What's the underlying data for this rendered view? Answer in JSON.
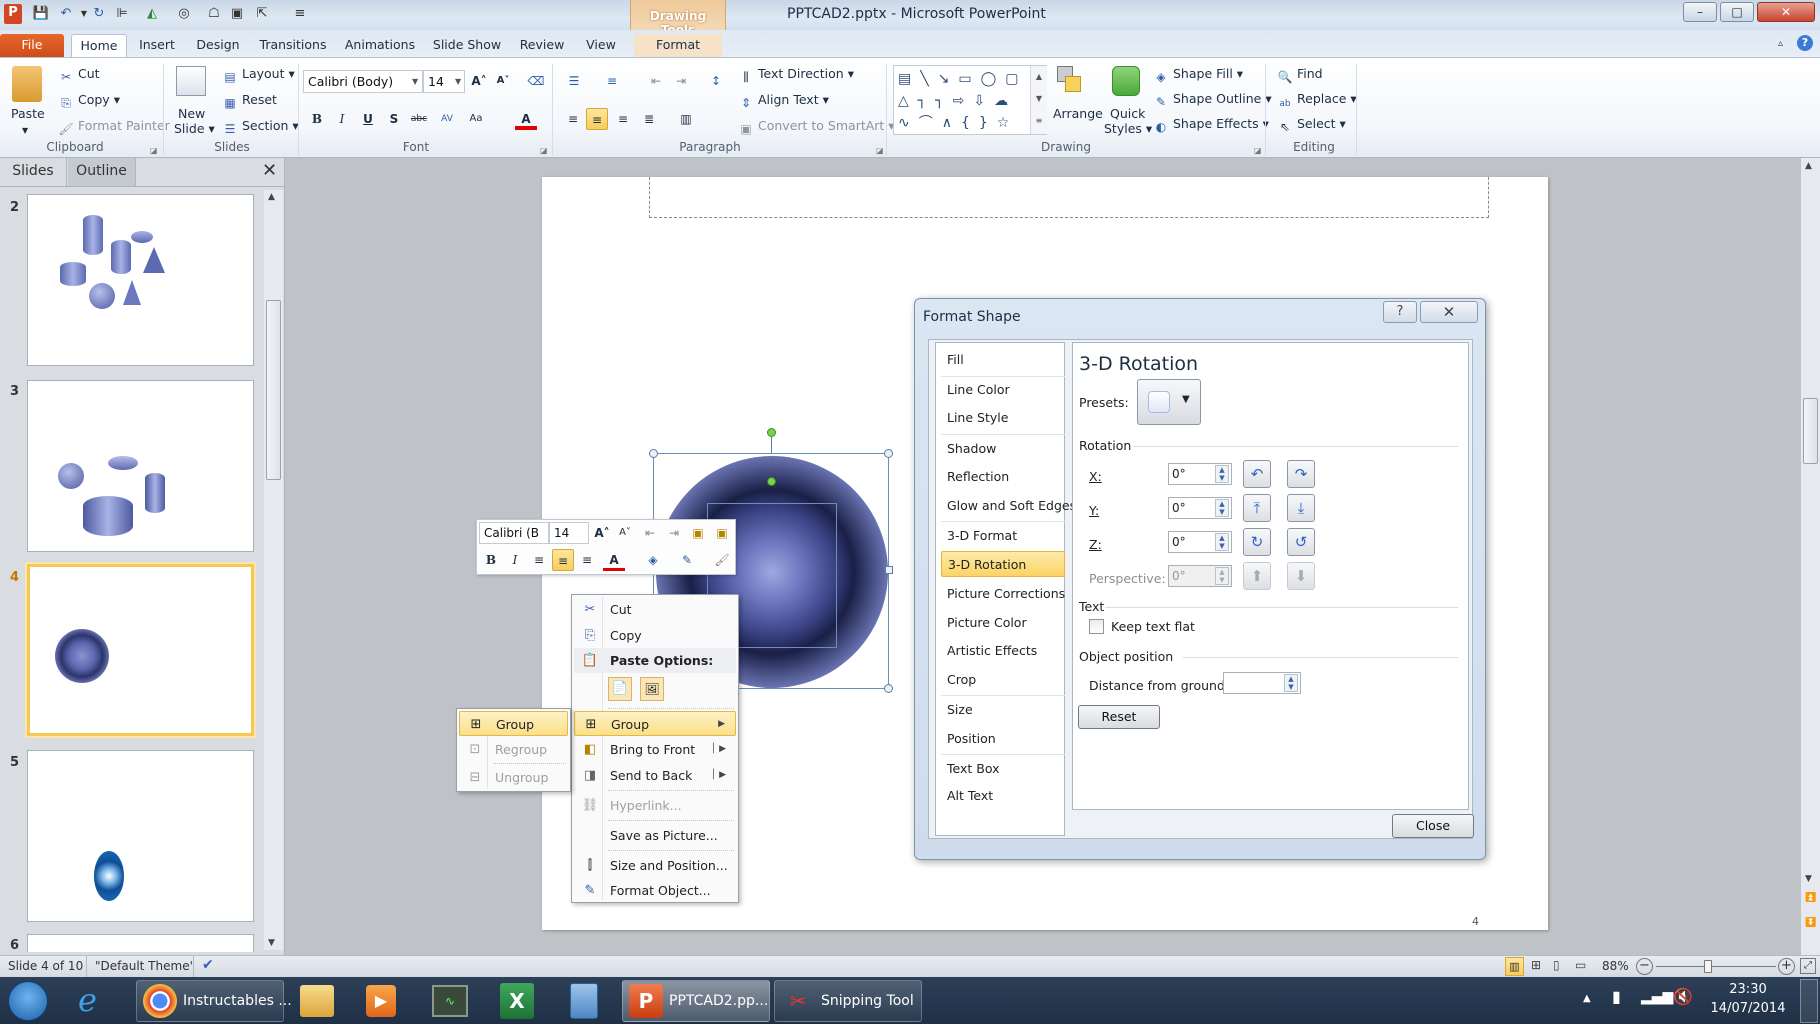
{
  "window": {
    "title": "PPTCAD2.pptx - Microsoft PowerPoint",
    "contextual_tab_group": "Drawing Tools",
    "controls": {
      "minimize": "–",
      "maximize": "□",
      "close": "✕"
    }
  },
  "quick_access": {
    "icons": [
      "save-icon",
      "undo-icon",
      "redo-icon",
      "align-icon",
      "fill-icon",
      "shapes-icon",
      "shape-icon",
      "resize-icon",
      "select-icon",
      "customize-icon"
    ]
  },
  "tabs": [
    {
      "label": "File"
    },
    {
      "label": "Home"
    },
    {
      "label": "Insert"
    },
    {
      "label": "Design"
    },
    {
      "label": "Transitions"
    },
    {
      "label": "Animations"
    },
    {
      "label": "Slide Show"
    },
    {
      "label": "Review"
    },
    {
      "label": "View"
    },
    {
      "label": "Format"
    }
  ],
  "ribbon": {
    "clipboard": {
      "label": "Clipboard",
      "paste": "Paste",
      "cut": "Cut",
      "copy": "Copy",
      "format_painter": "Format Painter"
    },
    "slides": {
      "label": "Slides",
      "new_slide_1": "New",
      "new_slide_2": "Slide",
      "layout": "Layout",
      "reset": "Reset",
      "section": "Section"
    },
    "font": {
      "label": "Font",
      "font_name": "Calibri (Body)",
      "font_size": "14"
    },
    "paragraph": {
      "label": "Paragraph",
      "text_direction": "Text Direction",
      "align_text": "Align Text",
      "convert_smartart": "Convert to SmartArt"
    },
    "drawing": {
      "label": "Drawing",
      "arrange": "Arrange",
      "quick_styles_1": "Quick",
      "quick_styles_2": "Styles",
      "shape_fill": "Shape Fill",
      "shape_outline": "Shape Outline",
      "shape_effects": "Shape Effects"
    },
    "editing": {
      "label": "Editing",
      "find": "Find",
      "replace": "Replace",
      "select": "Select"
    }
  },
  "left_pane": {
    "tabs": [
      "Slides",
      "Outline"
    ],
    "slides": [
      {
        "number": "2"
      },
      {
        "number": "3"
      },
      {
        "number": "4",
        "selected": true
      },
      {
        "number": "5"
      },
      {
        "number": "6"
      }
    ]
  },
  "slide": {
    "page_number": "4"
  },
  "mini_toolbar": {
    "font_name": "Calibri (B",
    "font_size": "14"
  },
  "context_menu": {
    "items": [
      {
        "label": "Cut",
        "icon": "cut-icon"
      },
      {
        "label": "Copy",
        "icon": "copy-icon"
      },
      {
        "label": "Paste Options:",
        "icon": "paste-icon",
        "header": true
      },
      {
        "label": "Group",
        "icon": "group-icon",
        "submenu": true,
        "highlighted": true
      },
      {
        "label": "Bring to Front",
        "icon": "bring-front-icon",
        "submenu": true
      },
      {
        "label": "Send to Back",
        "icon": "send-back-icon",
        "submenu": true
      },
      {
        "label": "Hyperlink...",
        "icon": "hyperlink-icon",
        "disabled": true
      },
      {
        "label": "Save as Picture..."
      },
      {
        "label": "Size and Position...",
        "icon": "size-position-icon"
      },
      {
        "label": "Format Object...",
        "icon": "format-object-icon"
      }
    ]
  },
  "group_submenu": {
    "items": [
      {
        "label": "Group",
        "highlighted": true
      },
      {
        "label": "Regroup",
        "disabled": true
      },
      {
        "label": "Ungroup",
        "disabled": true
      }
    ]
  },
  "format_shape_dialog": {
    "title": "Format Shape",
    "nav": [
      "Fill",
      "Line Color",
      "Line Style",
      "Shadow",
      "Reflection",
      "Glow and Soft Edges",
      "3-D Format",
      "3-D Rotation",
      "Picture Corrections",
      "Picture Color",
      "Artistic Effects",
      "Crop",
      "Size",
      "Position",
      "Text Box",
      "Alt Text"
    ],
    "selected_nav": "3-D Rotation",
    "heading": "3-D Rotation",
    "presets_label": "Presets:",
    "rotation_label": "Rotation",
    "x_label": "X:",
    "x_value": "0°",
    "y_label": "Y:",
    "y_value": "0°",
    "z_label": "Z:",
    "z_value": "0°",
    "perspective_label": "Perspective:",
    "perspective_value": "0°",
    "text_section": "Text",
    "keep_text_flat": "Keep text flat",
    "keep_text_flat_checked": false,
    "object_position": "Object position",
    "distance_label": "Distance from ground:",
    "distance_value": "",
    "reset": "Reset",
    "close": "Close"
  },
  "status_bar": {
    "slide_info": "Slide 4 of 10",
    "theme": "\"Default Theme\"",
    "zoom": "88%",
    "zoom_percent": 88
  },
  "taskbar": {
    "items": [
      {
        "label": "Instructables ...",
        "icon": "chrome-icon"
      },
      {
        "label": "PPTCAD2.pp...",
        "icon": "powerpoint-icon",
        "active": true
      },
      {
        "label": "Snipping Tool",
        "icon": "snipping-tool-icon"
      }
    ],
    "time": "23:30",
    "date": "14/07/2014"
  }
}
